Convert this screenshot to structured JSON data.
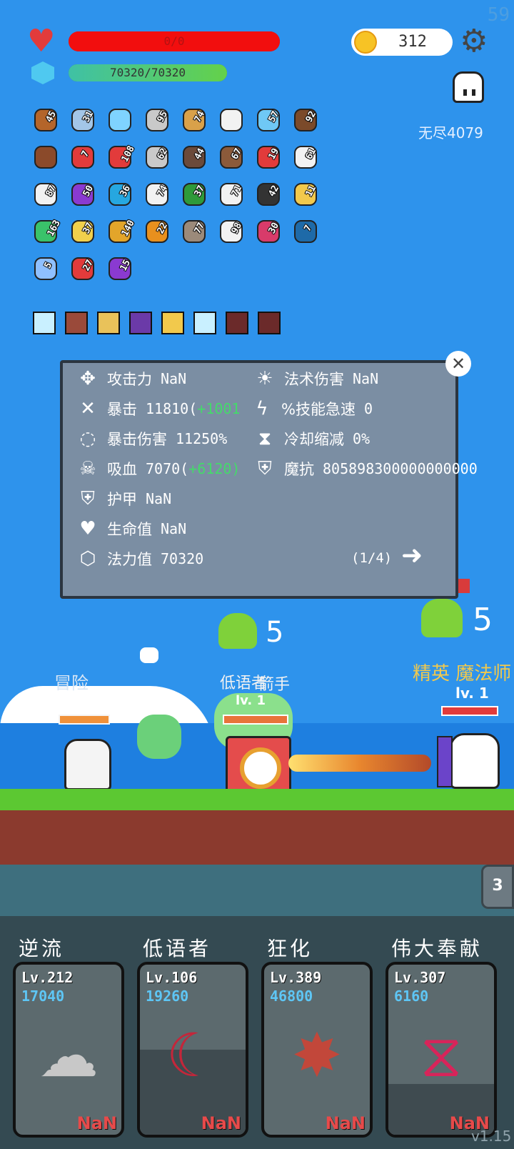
{
  "fps": "59",
  "hp": {
    "text": "0/0",
    "fraction": 1.0,
    "color": "#f20e0e"
  },
  "mana": {
    "text": "70320/70320",
    "fraction": 1.0
  },
  "coins": "312",
  "endless_label": "无尽4079",
  "items": [
    {
      "icon": "compass-icon",
      "count": "45"
    },
    {
      "icon": "sword-icon",
      "count": "31"
    },
    {
      "icon": "magnifier-icon",
      "count": ""
    },
    {
      "icon": "mace-icon",
      "count": "95"
    },
    {
      "icon": "crossbow-icon",
      "count": "74"
    },
    {
      "icon": "wings-icon",
      "count": ""
    },
    {
      "icon": "potion-icon",
      "count": "57"
    },
    {
      "icon": "coconut-icon",
      "count": "92"
    },
    {
      "icon": "chest-icon",
      "count": ""
    },
    {
      "icon": "heart-icon",
      "count": "7"
    },
    {
      "icon": "strawberry-icon",
      "count": "108"
    },
    {
      "icon": "axe-icon",
      "count": "62"
    },
    {
      "icon": "arrows-icon",
      "count": "44"
    },
    {
      "icon": "cup-icon",
      "count": "67"
    },
    {
      "icon": "shield-icon",
      "count": "19"
    },
    {
      "icon": "bulb-icon",
      "count": "61"
    },
    {
      "icon": "dice-icon",
      "count": "87"
    },
    {
      "icon": "cube-icon",
      "count": "50"
    },
    {
      "icon": "gem-icon",
      "count": "36"
    },
    {
      "icon": "pill-icon",
      "count": "74"
    },
    {
      "icon": "watermelon-icon",
      "count": "37"
    },
    {
      "icon": "letter-icon",
      "count": "71"
    },
    {
      "icon": "bomb-icon",
      "count": "42"
    },
    {
      "icon": "ring-icon",
      "count": "11"
    },
    {
      "icon": "seed-icon",
      "count": "163"
    },
    {
      "icon": "wand-icon",
      "count": "37"
    },
    {
      "icon": "flower-icon",
      "count": "140"
    },
    {
      "icon": "book-icon",
      "count": "22"
    },
    {
      "icon": "tombstone-icon",
      "count": "77"
    },
    {
      "icon": "ghost-icon",
      "count": "98"
    },
    {
      "icon": "jar-icon",
      "count": "30"
    },
    {
      "icon": "bird-icon",
      "count": "7"
    },
    {
      "icon": "hook-icon",
      "count": "5"
    },
    {
      "icon": "apple-icon",
      "count": "27"
    },
    {
      "icon": "crystal-ball-icon",
      "count": "15"
    }
  ],
  "skills": [
    "light-icon",
    "blade-icon",
    "shield-icon",
    "demon-icon",
    "skull-icon",
    "light-icon",
    "totem-icon",
    "totem-icon"
  ],
  "stats_left": [
    {
      "icon": "axe-icon",
      "label": "攻击力",
      "value": "NaN",
      "extra": ""
    },
    {
      "icon": "crit-icon",
      "label": "暴击",
      "value": "11810(",
      "extra": "+1001"
    },
    {
      "icon": "ring-dots-icon",
      "label": "暴击伤害",
      "value": "11250%",
      "extra": ""
    },
    {
      "icon": "vampire-icon",
      "label": "吸血",
      "value": "7070(",
      "extra": "+6120)"
    },
    {
      "icon": "armor-icon",
      "label": "护甲",
      "value": "NaN",
      "extra": ""
    },
    {
      "icon": "heart-icon",
      "label": "生命值",
      "value": "NaN",
      "extra": ""
    },
    {
      "icon": "mana-gem-icon",
      "label": "法力值",
      "value": "70320",
      "extra": ""
    }
  ],
  "stats_right": [
    {
      "icon": "sun-icon",
      "label": "法术伤害",
      "value": "NaN"
    },
    {
      "icon": "lightning-icon",
      "label": "%技能急速",
      "value": "0"
    },
    {
      "icon": "hourglass-icon",
      "label": "冷却缩减",
      "value": "0%"
    },
    {
      "icon": "magic-shield-icon",
      "label": "魔抗",
      "value": "805898300000000000"
    }
  ],
  "panel_page": "(1/4)",
  "battle": {
    "skull_count_left": "5",
    "skull_count_right": "5",
    "hero_name": "冒险",
    "enemy1_name": "低语者",
    "enemy1_name_overlap": "箭手",
    "enemy1_level": "lv. 1",
    "enemy2_label": "精英 魔法师",
    "enemy2_level": "lv. 1"
  },
  "side_counter": "3",
  "cards": [
    {
      "title": "逆流",
      "level": "Lv.212",
      "value": "17040",
      "cost": "NaN",
      "color": "#c8c8c8",
      "icon": "wings-icon",
      "fill": 0.0
    },
    {
      "title": "低语者",
      "level": "Lv.106",
      "value": "19260",
      "cost": "NaN",
      "color": "#c4263a",
      "icon": "moon-icon",
      "fill": 0.5
    },
    {
      "title": "狂化",
      "level": "Lv.389",
      "value": "46800",
      "cost": "NaN",
      "color": "#c2473a",
      "icon": "burst-icon",
      "fill": 0.0
    },
    {
      "title": "伟大奉献",
      "level": "Lv.307",
      "value": "6160",
      "cost": "NaN",
      "color": "#d8245a",
      "icon": "dna-icon",
      "fill": 0.3
    }
  ],
  "version": "v1.15"
}
